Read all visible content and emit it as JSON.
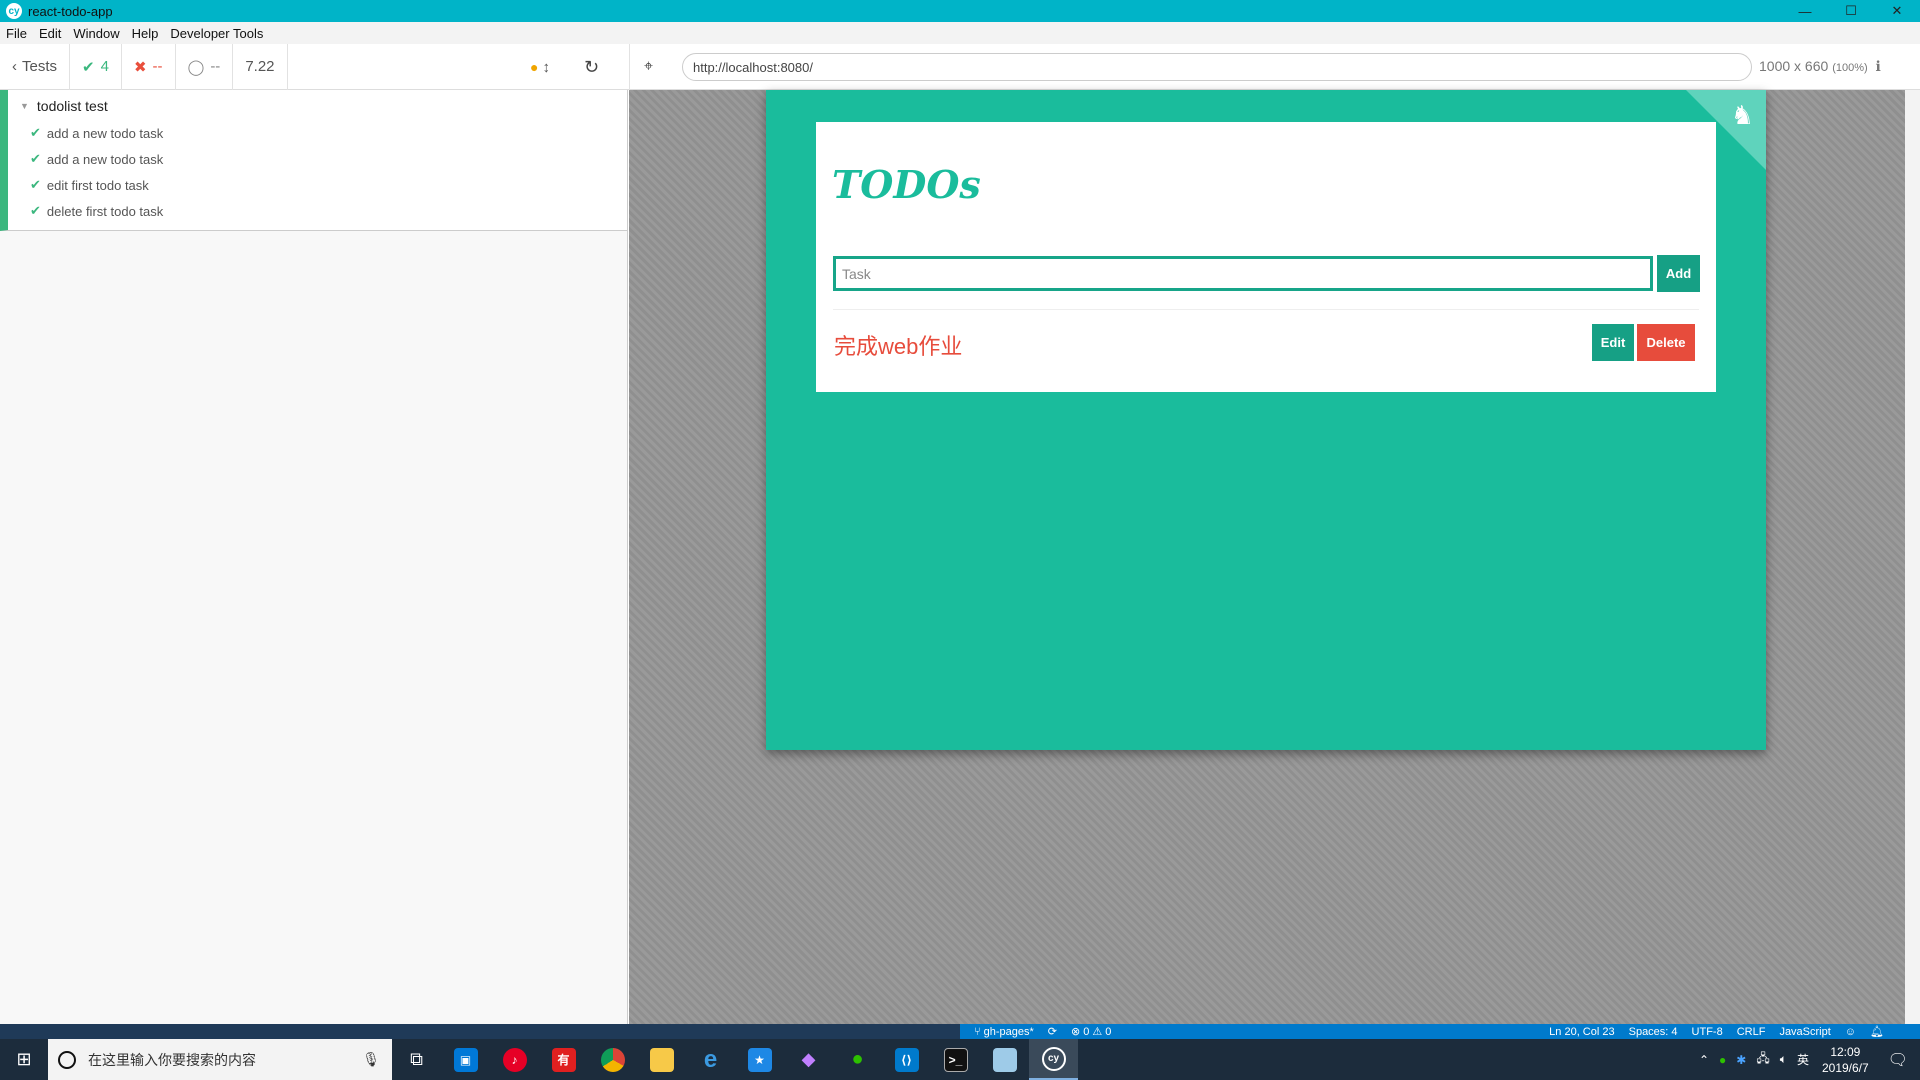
{
  "window": {
    "title": "react-todo-app"
  },
  "menu": [
    "File",
    "Edit",
    "Window",
    "Help",
    "Developer Tools"
  ],
  "toolbar": {
    "tests_label": "Tests",
    "passed": "4",
    "failed": "--",
    "pending": "--",
    "duration": "7.22",
    "url": "http://localhost:8080/",
    "viewport": "1000 x 660",
    "zoom": "(100%)"
  },
  "reporter": {
    "suite": "todolist test",
    "tests": [
      "add a new todo task",
      "add a new todo task",
      "edit first todo task",
      "delete first todo task"
    ]
  },
  "app": {
    "title": "TODOs",
    "input_placeholder": "Task",
    "add_label": "Add",
    "todo_text": "完成web作业",
    "edit_label": "Edit",
    "delete_label": "Delete"
  },
  "vscode_status": {
    "branch": "gh-pages*",
    "problems": "0 ⚠ 0",
    "position": "Ln 20, Col 23",
    "spaces": "Spaces: 4",
    "encoding": "UTF-8",
    "eol": "CRLF",
    "language": "JavaScript"
  },
  "taskbar": {
    "search_placeholder": "在这里输入你要搜索的内容",
    "time": "12:09",
    "date": "2019/6/7",
    "ime": "英"
  },
  "colors": {
    "accent": "#1abc9c",
    "danger": "#e74c3c",
    "pass": "#3bb77e"
  }
}
